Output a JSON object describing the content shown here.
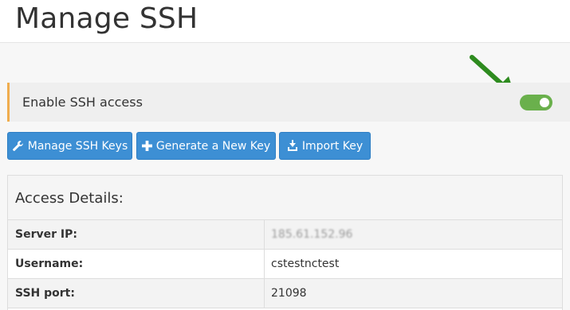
{
  "page": {
    "title": "Manage SSH"
  },
  "ssh_access": {
    "label": "Enable SSH access",
    "enabled": true,
    "toggle_color": "#6ab04c"
  },
  "annotation": {
    "arrow_color": "#2e8b1f"
  },
  "toolbar": {
    "buttons": [
      {
        "label": "Manage SSH Keys",
        "icon": "wrench-icon"
      },
      {
        "label": "Generate a New Key",
        "icon": "plus-icon"
      },
      {
        "label": "Import Key",
        "icon": "import-icon"
      }
    ],
    "button_color": "#3d8fd4"
  },
  "access_details": {
    "title": "Access Details:",
    "rows": [
      {
        "label": "Server IP:",
        "value": "185.61.152.96"
      },
      {
        "label": "Username:",
        "value": "cstestnctest"
      },
      {
        "label": "SSH port:",
        "value": "21098"
      }
    ]
  }
}
